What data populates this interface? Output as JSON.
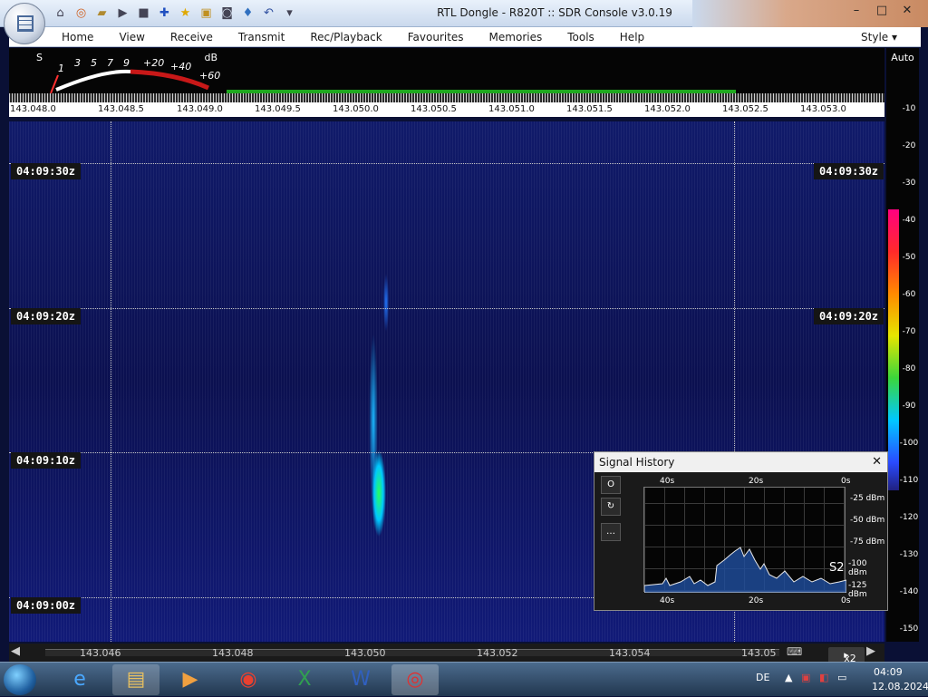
{
  "window": {
    "title": "RTL Dongle - R820T :: SDR Console v3.0.19",
    "style_label": "Style"
  },
  "menu": [
    "Home",
    "View",
    "Receive",
    "Transmit",
    "Rec/Playback",
    "Favourites",
    "Memories",
    "Tools",
    "Help"
  ],
  "meter": {
    "s_label": "S",
    "db_label": "dB",
    "s_scale": [
      "1",
      "3",
      "5",
      "7",
      "9"
    ],
    "db_scale": [
      "+20",
      "+40",
      "+60"
    ]
  },
  "freq_axis": [
    "143.048.0",
    "143.048.5",
    "143.049.0",
    "143.049.5",
    "143.050.0",
    "143.050.5",
    "143.051.0",
    "143.051.5",
    "143.052.0",
    "143.052.5",
    "143.053.0"
  ],
  "time_labels": [
    "04:09:30z",
    "04:09:20z",
    "04:09:10z",
    "04:09:00z"
  ],
  "color_scale": {
    "auto_label": "Auto",
    "levels": [
      "-10",
      "-20",
      "-30",
      "-40",
      "-50",
      "-60",
      "-70",
      "-80",
      "-90",
      "-100",
      "-110",
      "-120",
      "-130",
      "-140",
      "-150"
    ]
  },
  "bottom_axis": [
    "143.046",
    "143.048",
    "143.050",
    "143.052",
    "143.054",
    "143.05"
  ],
  "zoom_label": "x2",
  "signal_history": {
    "title": "Signal History",
    "time_top": [
      "40s",
      "20s",
      "0s"
    ],
    "time_bottom": [
      "40s",
      "20s",
      "0s"
    ],
    "levels": [
      "-25 dBm",
      "-50 dBm",
      "-75 dBm",
      "-100 dBm",
      "-125 dBm"
    ],
    "s_reading": "S2",
    "buttons": [
      "O",
      "↻",
      "…"
    ]
  },
  "taskbar": {
    "language": "DE",
    "time": "04:09",
    "date": "12.08.2024"
  }
}
